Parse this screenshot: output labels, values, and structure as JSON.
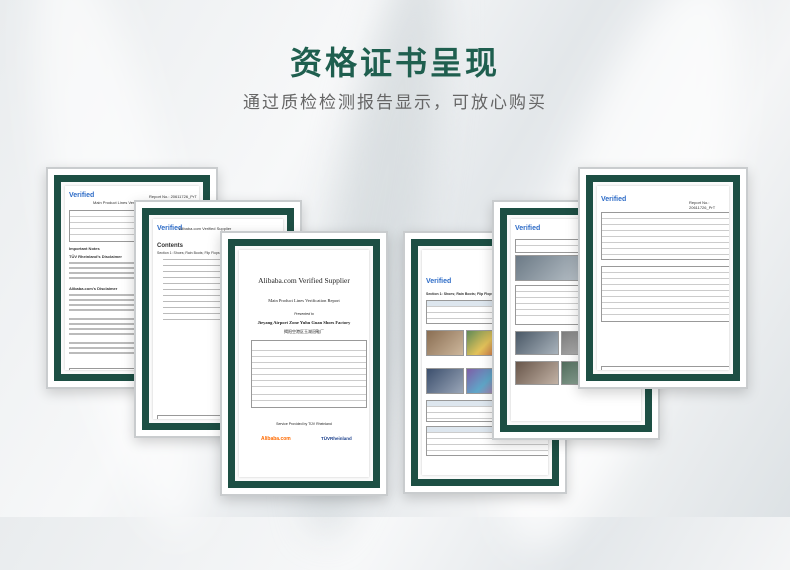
{
  "header": {
    "title": "资格证书呈现",
    "subtitle": "通过质检检测报告显示，可放心购买"
  },
  "documents": {
    "brand_mark": "Verified",
    "cert_title": "Alibaba.com Verified Supplier",
    "cert_subtitle": "Main Product Lines Verification Report",
    "presented_to": "Presented to",
    "company_en": "Jieyang Airport Zone Yuhu Guan Shoes Factory",
    "company_cn": "揭阳空港区玉湖冠鞋厂",
    "service_note": "Service Provided by TÜV Rheinland",
    "report_no": "Report No.: 20611726_PrT",
    "alibaba_logo": "Alibaba.com",
    "tuv_logo": "TÜVRheinland",
    "contents_heading": "Contents",
    "section_heading": "Section 1: Shoes; Rain Boots; Flip Flops; Sandals",
    "left_heading": "TÜV Rheinland's Disclaimer",
    "product_lines_header": "Main Product Lines Verification",
    "report_no_short": "Report No.: 20611726_PrT",
    "notes_heading": "Important Notes",
    "disclaimer_2": "Alibaba.com's Disclaimer"
  }
}
